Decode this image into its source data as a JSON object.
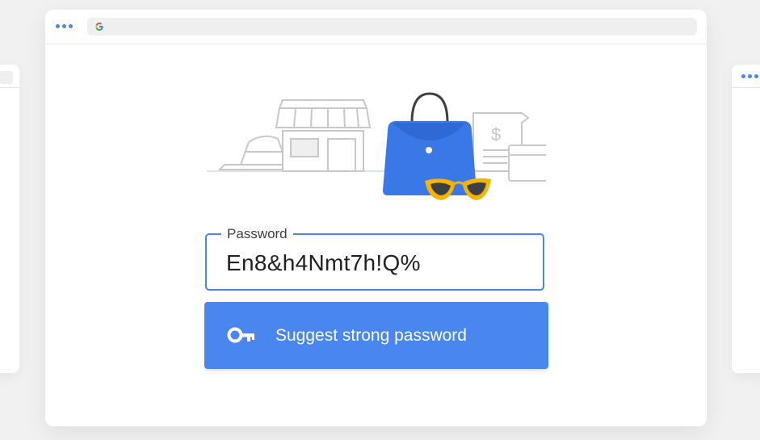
{
  "browser": {
    "menu_icon": "three-dots-icon",
    "address_icon": "google-g-icon"
  },
  "illustration": {
    "items": [
      "hat-icon",
      "storefront-icon",
      "handbag-icon",
      "sunglasses-icon",
      "receipt-icon",
      "credit-card-icon"
    ],
    "receipt_symbol": "$",
    "colors": {
      "handbag": "#3b78e7",
      "sunglasses": "#f4b400",
      "outline": "#c8c8c8"
    }
  },
  "password_field": {
    "label": "Password",
    "value": "En8&h4Nmt7h!Q%"
  },
  "suggest_button": {
    "icon": "key-icon",
    "label": "Suggest strong password"
  },
  "colors": {
    "accent": "#4a86ef",
    "background": "#f1f1f1",
    "window": "#ffffff"
  }
}
